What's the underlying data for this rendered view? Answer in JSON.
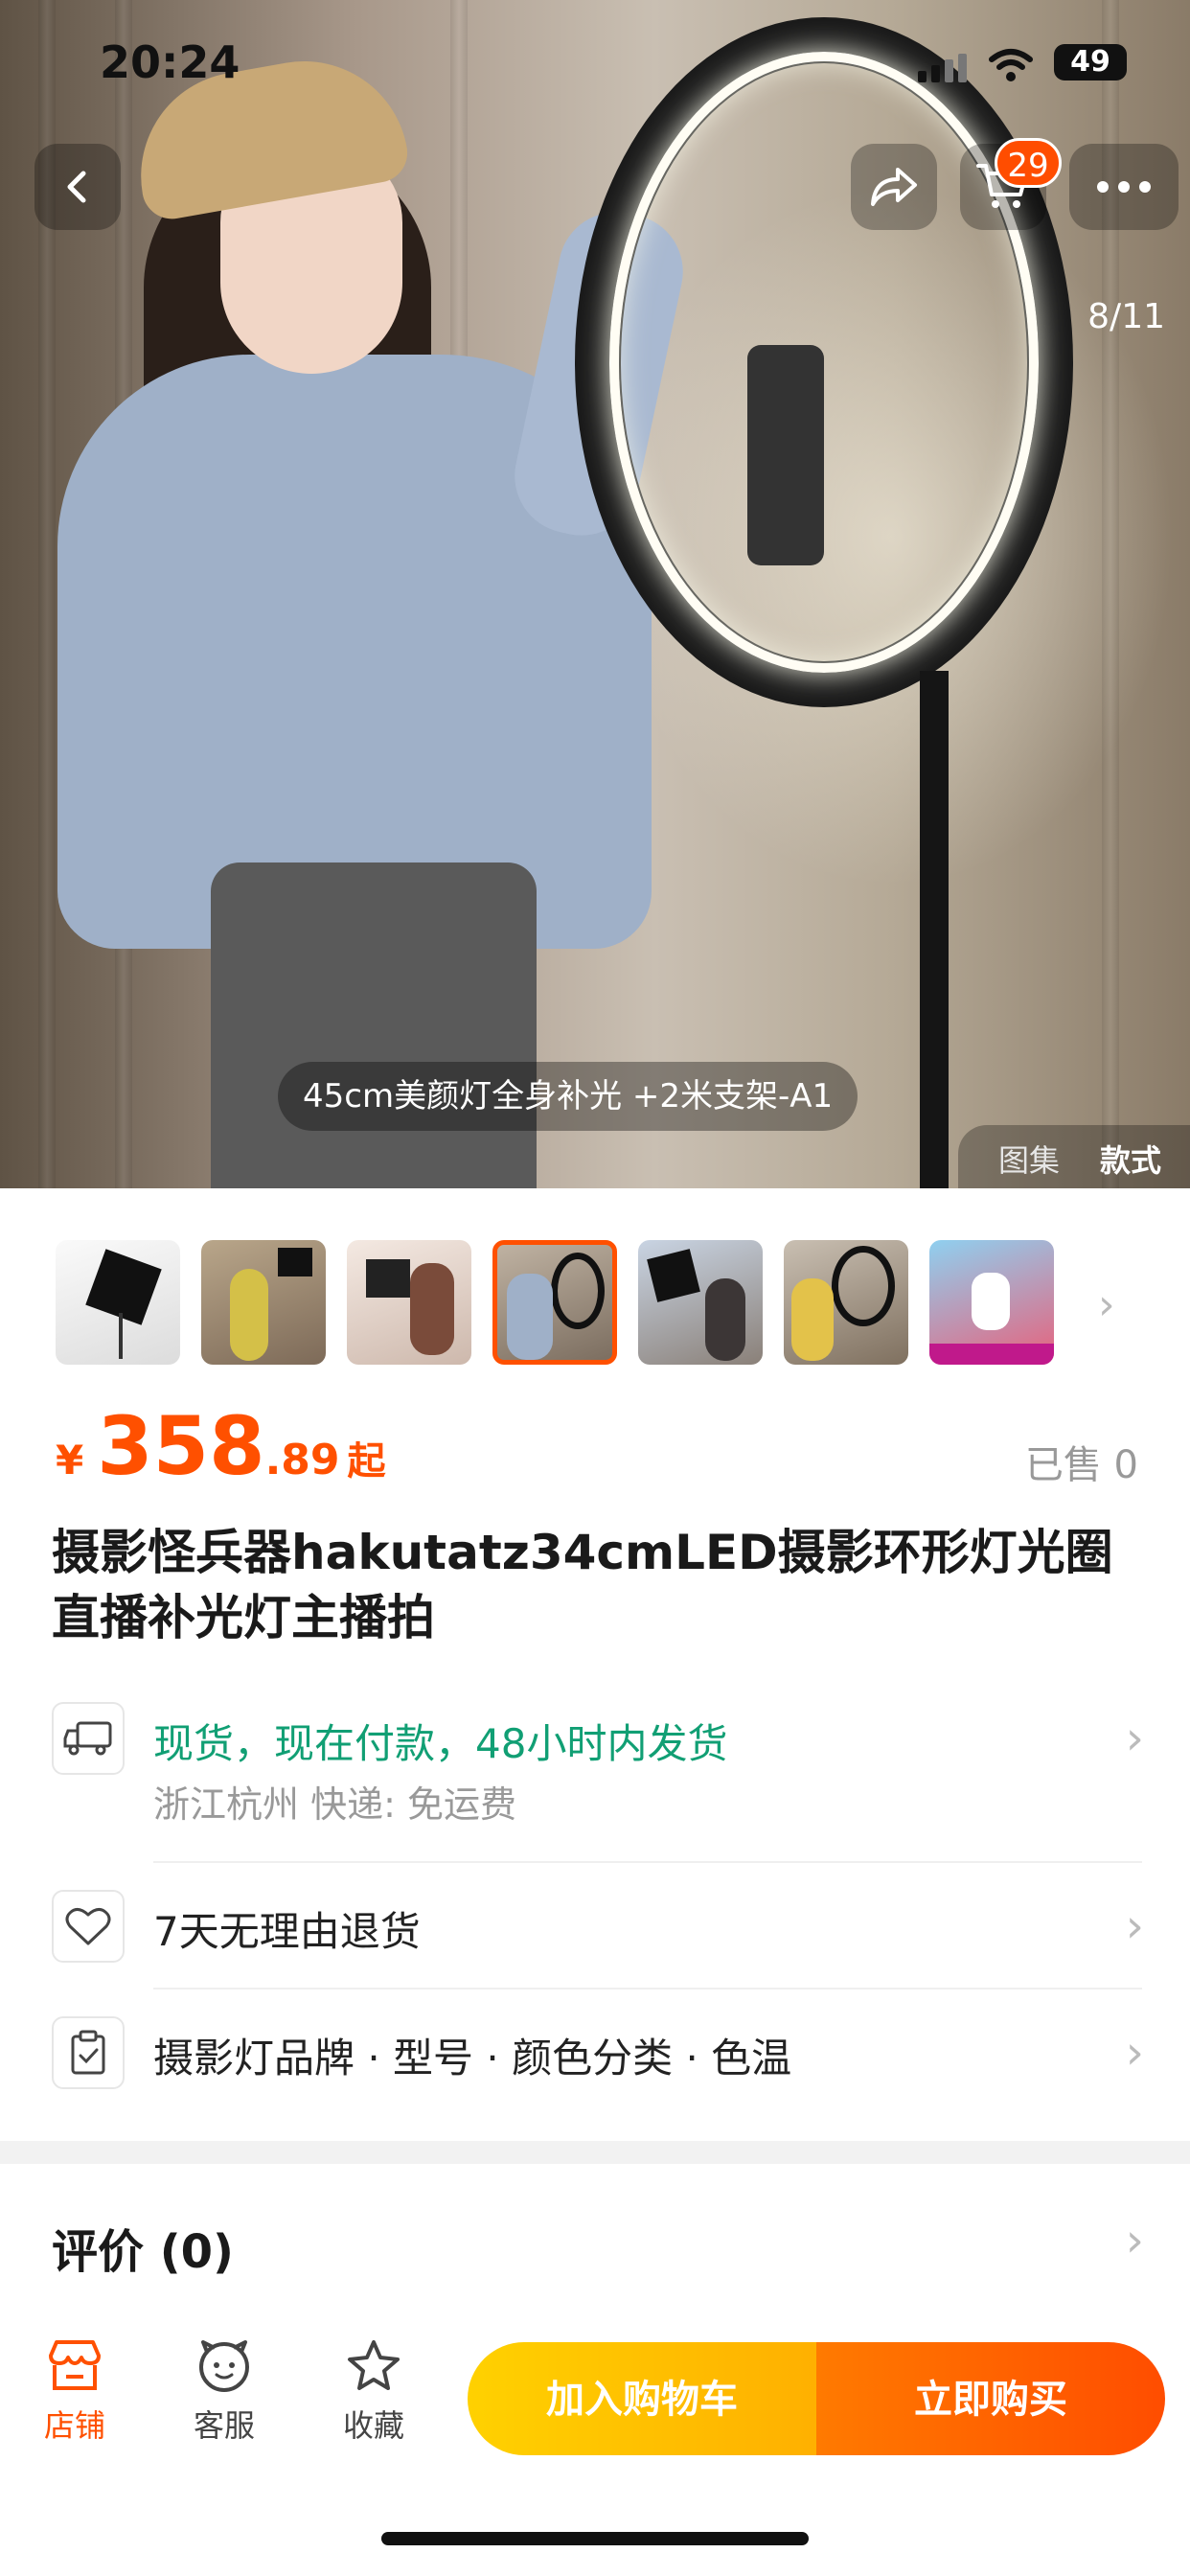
{
  "status_bar": {
    "time": "20:24",
    "battery": "49"
  },
  "header": {
    "cart_count": "29"
  },
  "gallery": {
    "counter": "8/11",
    "caption": "45cm美颜灯全身补光 +2米支架-A1",
    "tab_gallery": "图集",
    "tab_style": "款式",
    "thumbnail_count": 7,
    "selected_thumbnail": 4
  },
  "price": {
    "currency": "¥",
    "integer": "358",
    "decimal": ".89",
    "suffix": "起"
  },
  "sold": "已售 0",
  "title": "摄影怪兵器hakutatz34cmLED摄影环形灯光圈直播补光灯主播拍",
  "shipping": {
    "main": "现货，现在付款，48小时内发货",
    "sub": "浙江杭州  快递: 免运费"
  },
  "returns": "7天无理由退货",
  "params": "摄影灯品牌 · 型号 · 颜色分类 · 色温",
  "reviews": "评价 (0)",
  "bottom_bar": {
    "store": "店铺",
    "service": "客服",
    "favorite": "收藏",
    "add_to_cart": "加入购物车",
    "buy_now": "立即购买"
  },
  "colors": {
    "accent": "#ff5000",
    "green": "#119f74",
    "cart_button": "#ffc000",
    "buy_button": "#ff6200"
  }
}
